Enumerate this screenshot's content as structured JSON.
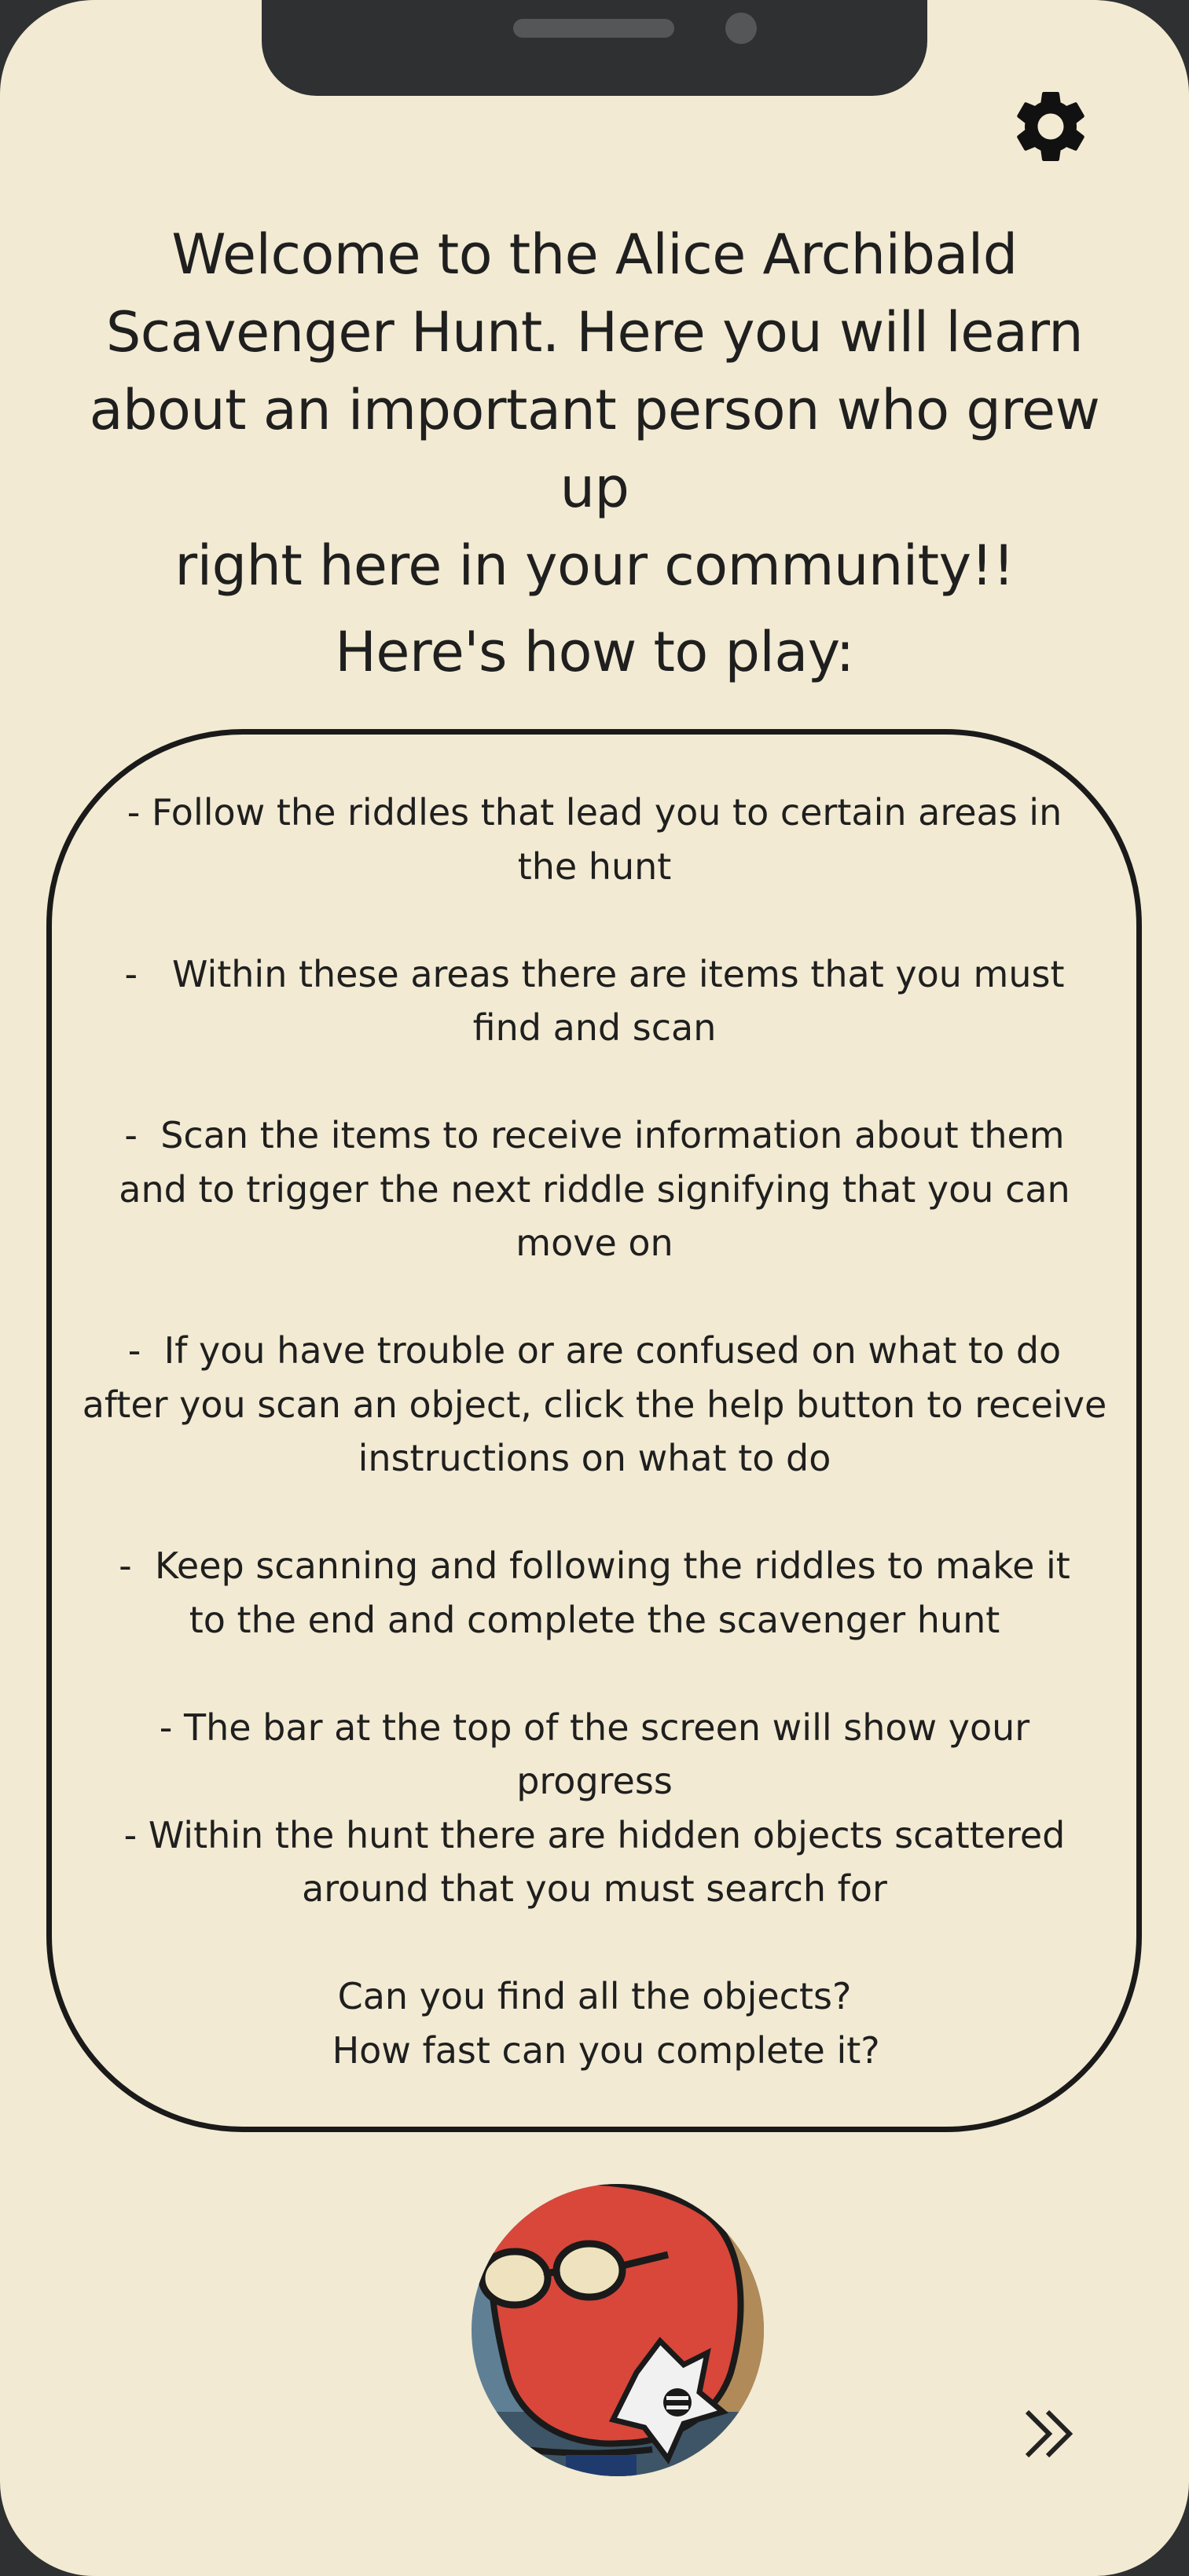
{
  "intro": {
    "welcome_lines": [
      "Welcome to the Alice Archibald",
      "Scavenger Hunt. Here you will learn",
      "about an important person who grew up",
      "right here in your community!!"
    ],
    "heading": "Here's how to play:"
  },
  "rules": [
    [
      "- Follow the riddles that lead you to certain areas in",
      "the hunt"
    ],
    [
      "-   Within these areas there are items that you must",
      "find and scan"
    ],
    [
      "-  Scan the items to receive information about them",
      "and to trigger the next riddle signifying that you can",
      "move on"
    ],
    [
      "-  If you have trouble or are confused on what to do",
      "after you scan an object, click the help button to receive",
      "instructions on what to do"
    ],
    [
      "-  Keep scanning and following the riddles to make it",
      "to the end and complete the scavenger hunt"
    ],
    [
      "- The bar at the top of the screen will show your",
      "progress",
      "- Within the hunt there are hidden objects scattered",
      "around that you must search for"
    ],
    [
      "Can you find all the objects?",
      "  How fast can you complete it?"
    ]
  ],
  "icons": {
    "settings": "gear-icon",
    "next": "double-chevron-right-icon"
  },
  "colors": {
    "background": "#f2ead2",
    "frame": "#2f3032",
    "text": "#1f1f1f",
    "avatar_red": "#d8473a"
  }
}
